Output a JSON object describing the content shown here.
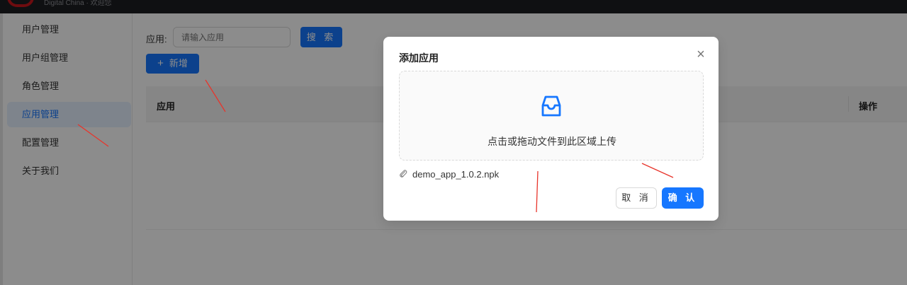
{
  "header": {
    "brand_text": "Digital China · 欢迎您"
  },
  "sidebar": {
    "items": [
      {
        "label": "用户管理",
        "active": false
      },
      {
        "label": "用户组管理",
        "active": false
      },
      {
        "label": "角色管理",
        "active": false
      },
      {
        "label": "应用管理",
        "active": true
      },
      {
        "label": "配置管理",
        "active": false
      },
      {
        "label": "关于我们",
        "active": false
      }
    ]
  },
  "filter": {
    "label": "应用:",
    "placeholder": "请输入应用",
    "search_label": "搜 索"
  },
  "toolbar": {
    "add_icon": "+",
    "add_label": "新增"
  },
  "table": {
    "columns": [
      "应用",
      "操作"
    ]
  },
  "modal": {
    "title": "添加应用",
    "close_icon": "×",
    "upload_icon": "inbox-icon",
    "upload_hint": "点击或拖动文件到此区域上传",
    "file_name": "demo_app_1.0.2.npk",
    "cancel_label": "取 消",
    "ok_label": "确 认"
  },
  "colors": {
    "primary": "#1677ff",
    "annotation": "#e8342b",
    "topbar": "#1d1e22"
  }
}
